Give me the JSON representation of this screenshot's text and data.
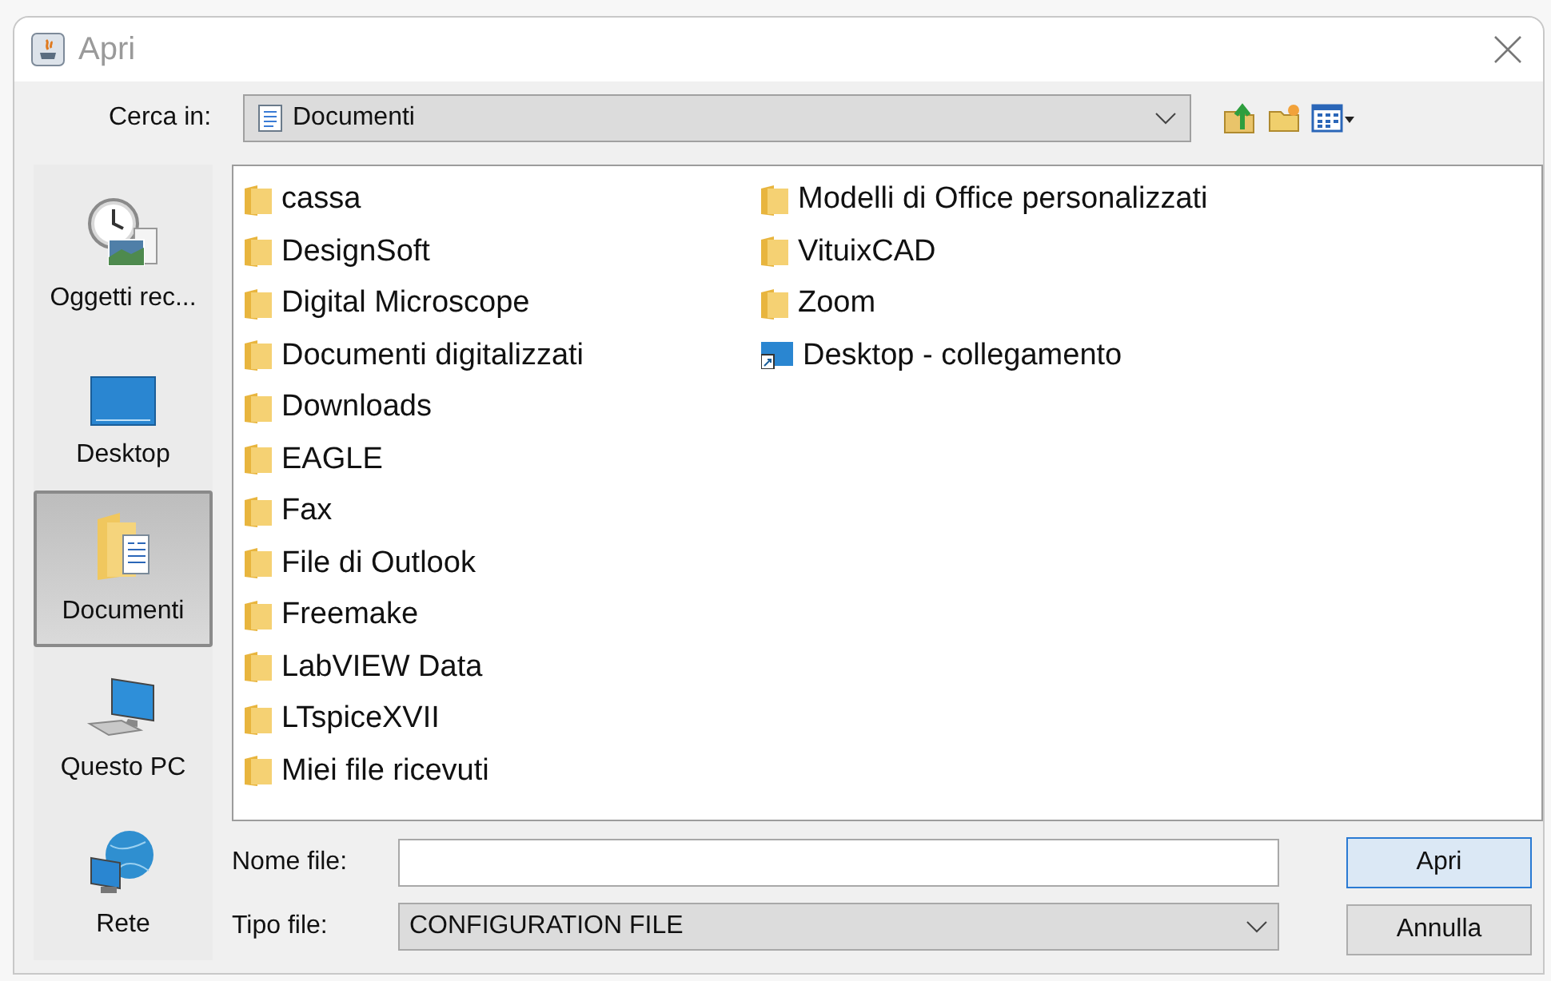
{
  "window": {
    "title": "Apri"
  },
  "look_in": {
    "label": "Cerca in:",
    "value": "Documenti"
  },
  "places": [
    {
      "label": "Oggetti rec...",
      "kind": "recent",
      "selected": false
    },
    {
      "label": "Desktop",
      "kind": "desktop",
      "selected": false
    },
    {
      "label": "Documenti",
      "kind": "documents",
      "selected": true
    },
    {
      "label": "Questo PC",
      "kind": "computer",
      "selected": false
    },
    {
      "label": "Rete",
      "kind": "network",
      "selected": false
    }
  ],
  "files": [
    {
      "name": "cassa",
      "kind": "folder"
    },
    {
      "name": "DesignSoft",
      "kind": "folder"
    },
    {
      "name": "Digital Microscope",
      "kind": "folder"
    },
    {
      "name": "Documenti digitalizzati",
      "kind": "folder"
    },
    {
      "name": "Downloads",
      "kind": "folder"
    },
    {
      "name": "EAGLE",
      "kind": "folder"
    },
    {
      "name": "Fax",
      "kind": "folder"
    },
    {
      "name": "File di Outlook",
      "kind": "folder"
    },
    {
      "name": "Freemake",
      "kind": "folder"
    },
    {
      "name": "LabVIEW Data",
      "kind": "folder"
    },
    {
      "name": "LTspiceXVII",
      "kind": "folder"
    },
    {
      "name": "Miei file ricevuti",
      "kind": "folder"
    },
    {
      "name": "Modelli di Office personalizzati",
      "kind": "folder"
    },
    {
      "name": "VituixCAD",
      "kind": "folder"
    },
    {
      "name": "Zoom",
      "kind": "folder"
    },
    {
      "name": "Desktop - collegamento",
      "kind": "shortcut"
    }
  ],
  "file_name": {
    "label": "Nome file:"
  },
  "file_type": {
    "label": "Tipo file:",
    "value": "CONFIGURATION FILE"
  },
  "buttons": [
    "Apri",
    "Annulla"
  ]
}
